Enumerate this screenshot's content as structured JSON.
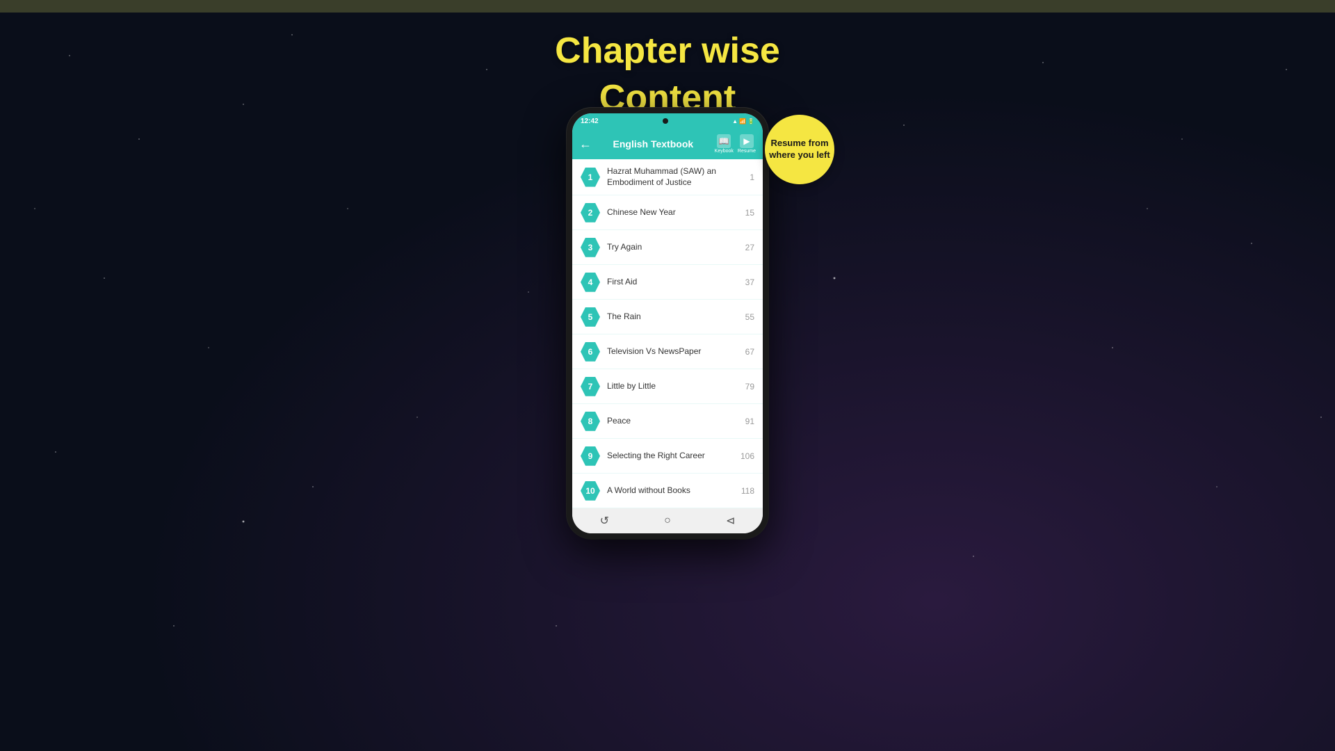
{
  "topStrip": {},
  "background": {
    "type": "starry-night"
  },
  "pageTitle": {
    "line1": "Chapter wise",
    "line2": "Content"
  },
  "resumeBubble": {
    "text": "Resume from where you left"
  },
  "phone": {
    "statusBar": {
      "time": "12:42",
      "icons": "📶🔋"
    },
    "toolbar": {
      "title": "English Textbook",
      "keybook_label": "Keybook",
      "resume_label": "Resume"
    },
    "chapters": [
      {
        "num": "1",
        "name": "Hazrat Muhammad (SAW) an Embodiment of Justice",
        "page": "1"
      },
      {
        "num": "2",
        "name": "Chinese New Year",
        "page": "15"
      },
      {
        "num": "3",
        "name": "Try Again",
        "page": "27"
      },
      {
        "num": "4",
        "name": "First Aid",
        "page": "37"
      },
      {
        "num": "5",
        "name": "The Rain",
        "page": "55"
      },
      {
        "num": "6",
        "name": "Television Vs NewsPaper",
        "page": "67"
      },
      {
        "num": "7",
        "name": "Little by Little",
        "page": "79"
      },
      {
        "num": "8",
        "name": "Peace",
        "page": "91"
      },
      {
        "num": "9",
        "name": "Selecting the Right Career",
        "page": "106"
      },
      {
        "num": "10",
        "name": "A World without Books",
        "page": "118"
      }
    ],
    "bottomNav": {
      "refresh": "↺",
      "home": "○",
      "back": "⊲"
    }
  }
}
